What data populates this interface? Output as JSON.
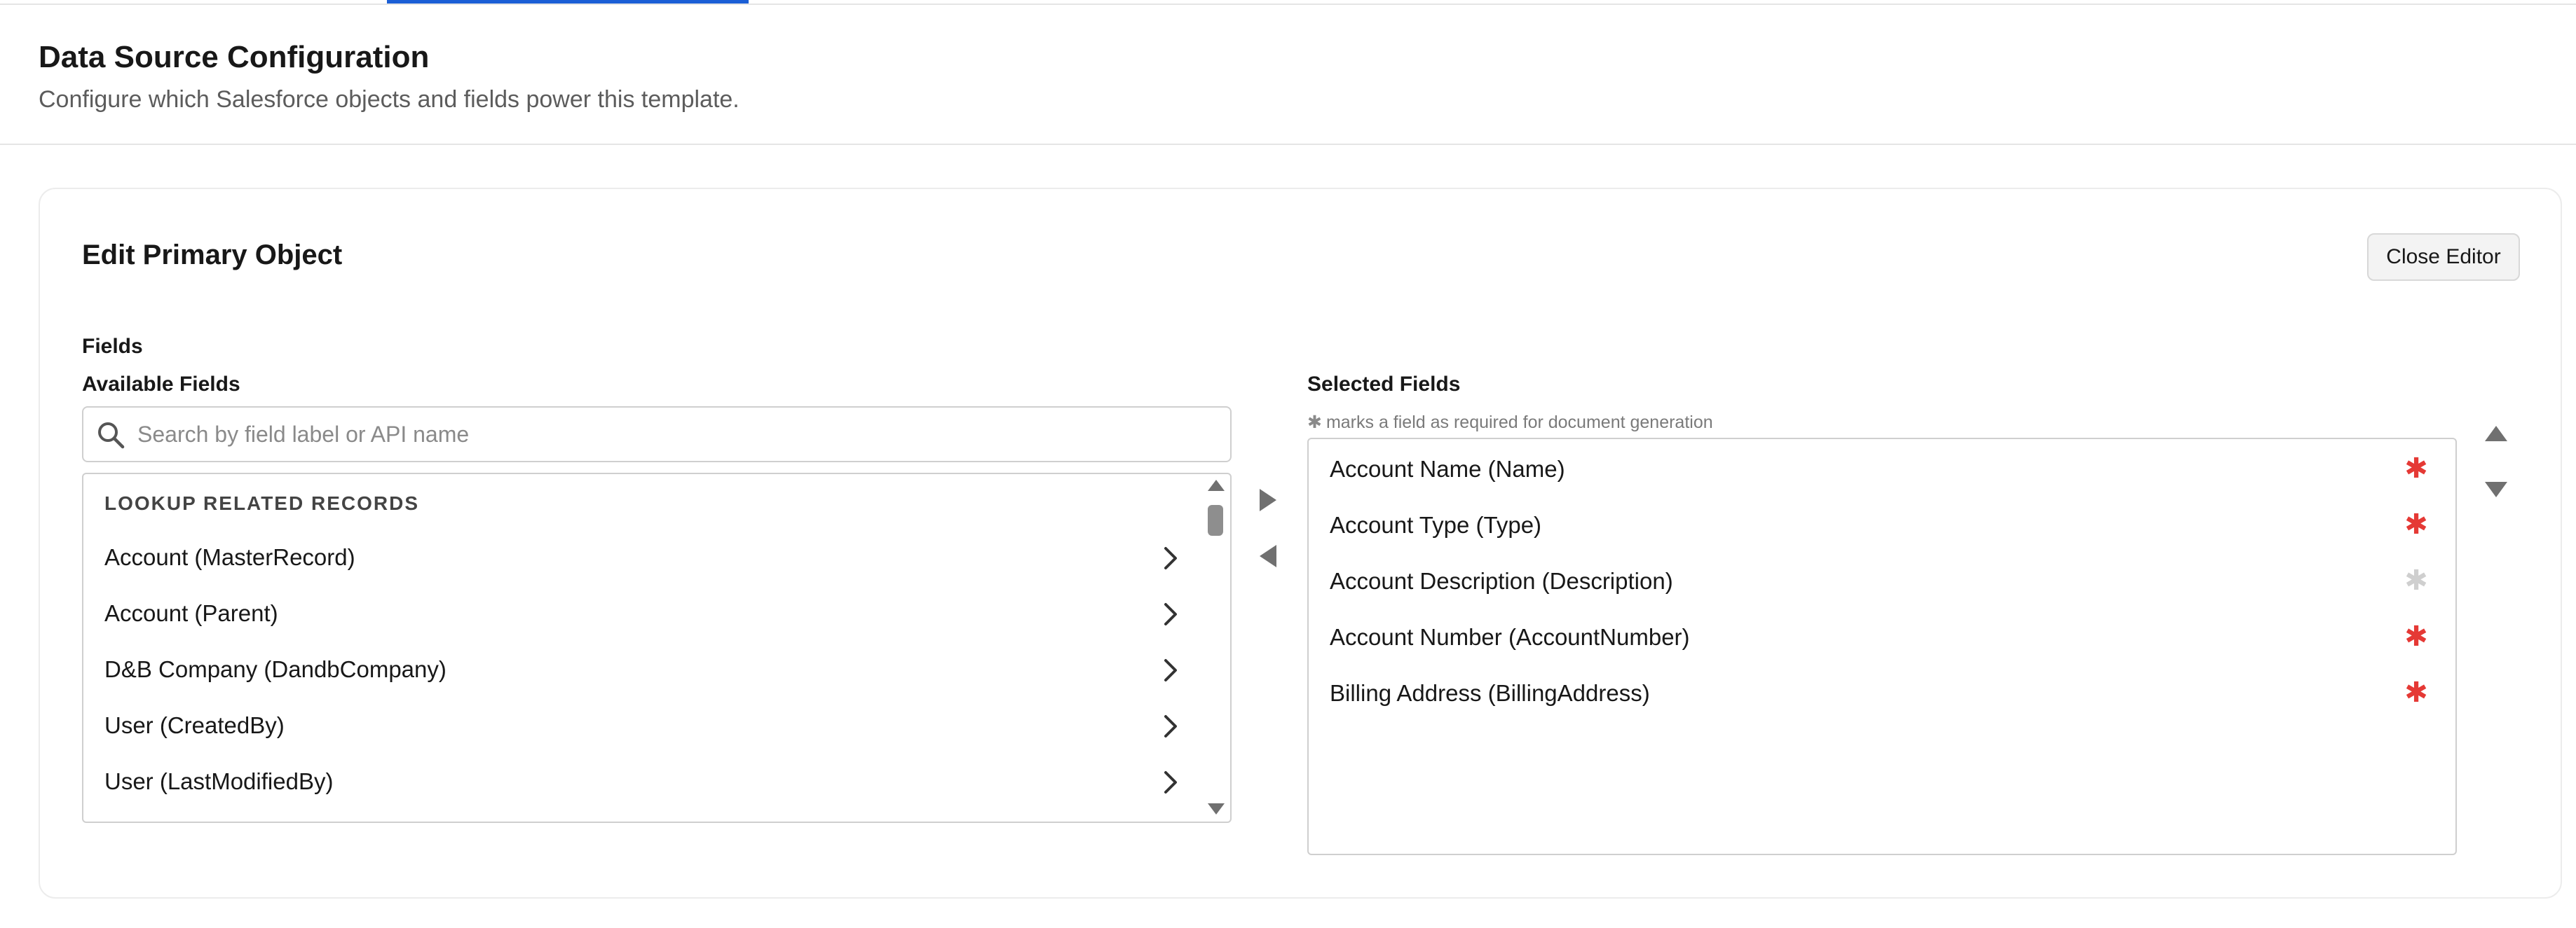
{
  "header": {
    "title": "Data Source Configuration",
    "subtitle": "Configure which Salesforce objects and fields power this template."
  },
  "editor": {
    "title": "Edit Primary Object",
    "close_label": "Close Editor",
    "fields_label": "Fields",
    "available_label": "Available Fields",
    "selected_label": "Selected Fields",
    "required_hint_star": "✱",
    "required_hint": "marks a field as required for document generation",
    "search": {
      "placeholder": "Search by field label or API name",
      "value": ""
    },
    "available": {
      "group_header": "LOOKUP RELATED RECORDS",
      "items": [
        {
          "label": "Account (MasterRecord)"
        },
        {
          "label": "Account (Parent)"
        },
        {
          "label": "D&B Company (DandbCompany)"
        },
        {
          "label": "User (CreatedBy)"
        },
        {
          "label": "User (LastModifiedBy)"
        }
      ]
    },
    "selected": {
      "items": [
        {
          "label": "Account Name (Name)",
          "required": true
        },
        {
          "label": "Account Type (Type)",
          "required": true
        },
        {
          "label": "Account Description (Description)",
          "required": false
        },
        {
          "label": "Account Number (AccountNumber)",
          "required": true
        },
        {
          "label": "Billing Address (BillingAddress)",
          "required": true
        }
      ],
      "star_glyph": "✱"
    }
  },
  "colors": {
    "accent": "#1b5fd6",
    "required_on": "#e53935",
    "required_off": "#cfcfcf"
  },
  "icons": {
    "search": "search-icon",
    "chevron": "chevron-right-icon",
    "required": "required-star-icon",
    "move_right": "move-right-arrow-icon",
    "move_left": "move-left-arrow-icon",
    "move_up": "move-up-arrow-icon",
    "move_down": "move-down-arrow-icon"
  }
}
